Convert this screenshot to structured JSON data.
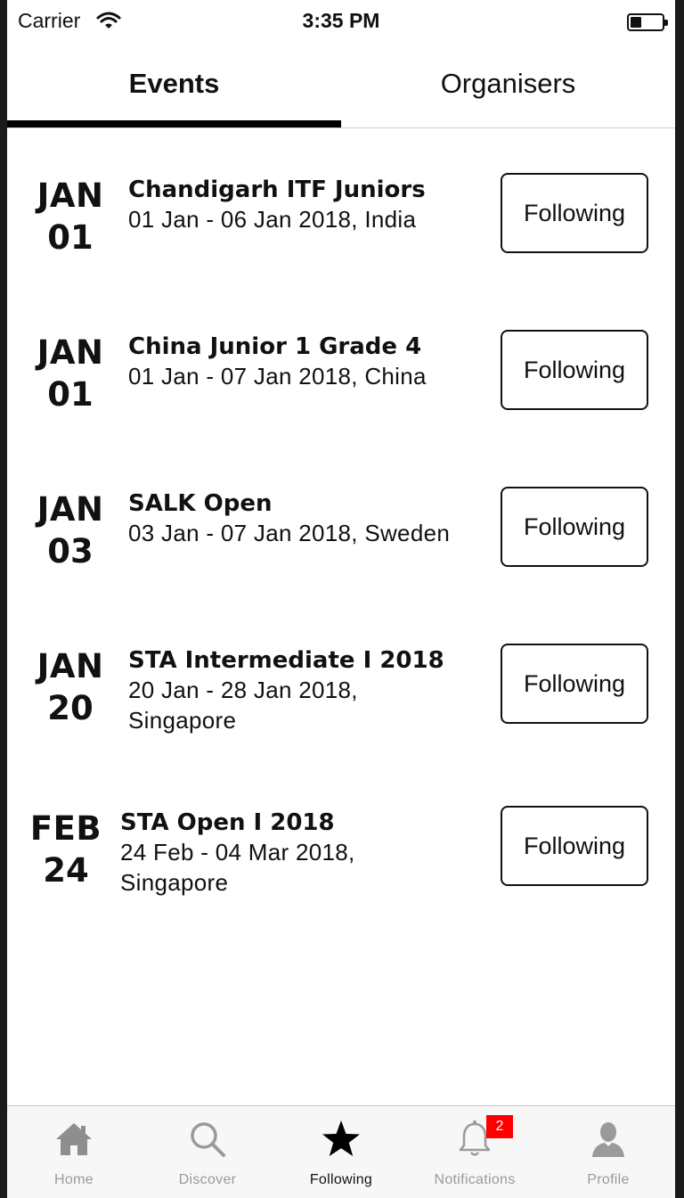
{
  "status_bar": {
    "carrier": "Carrier",
    "time": "3:35 PM"
  },
  "tabs": [
    {
      "label": "Events",
      "active": true
    },
    {
      "label": "Organisers",
      "active": false
    }
  ],
  "events": [
    {
      "month": "JAN",
      "day": "01",
      "title": "Chandigarh ITF Juniors",
      "line1": "01 Jan - 06 Jan 2018, India",
      "line2": "",
      "follow_label": "Following"
    },
    {
      "month": "JAN",
      "day": "01",
      "title": "China Junior 1 Grade 4",
      "line1": "01 Jan - 07 Jan 2018, China",
      "line2": "",
      "follow_label": "Following"
    },
    {
      "month": "JAN",
      "day": "03",
      "title": "SALK Open",
      "line1": "03 Jan - 07 Jan 2018, Sweden",
      "line2": "",
      "follow_label": "Following"
    },
    {
      "month": "JAN",
      "day": "20",
      "title": "STA Intermediate I 2018",
      "line1": "20 Jan - 28 Jan 2018,",
      "line2": "Singapore",
      "follow_label": "Following"
    },
    {
      "month": "FEB",
      "day": "24",
      "title": "STA Open I 2018",
      "line1": "24 Feb - 04 Mar 2018,",
      "line2": "Singapore",
      "follow_label": "Following"
    }
  ],
  "tab_bar": {
    "items": [
      {
        "label": "Home",
        "icon": "home-icon",
        "active": false
      },
      {
        "label": "Discover",
        "icon": "search-icon",
        "active": false
      },
      {
        "label": "Following",
        "icon": "star-icon",
        "active": true
      },
      {
        "label": "Notifications",
        "icon": "bell-icon",
        "active": false,
        "badge": "2"
      },
      {
        "label": "Profile",
        "icon": "person-icon",
        "active": false
      }
    ]
  },
  "colors": {
    "text": "#111111",
    "inactive_tab": "#9a9a9a",
    "badge": "#ff0000",
    "background": "#ffffff"
  }
}
